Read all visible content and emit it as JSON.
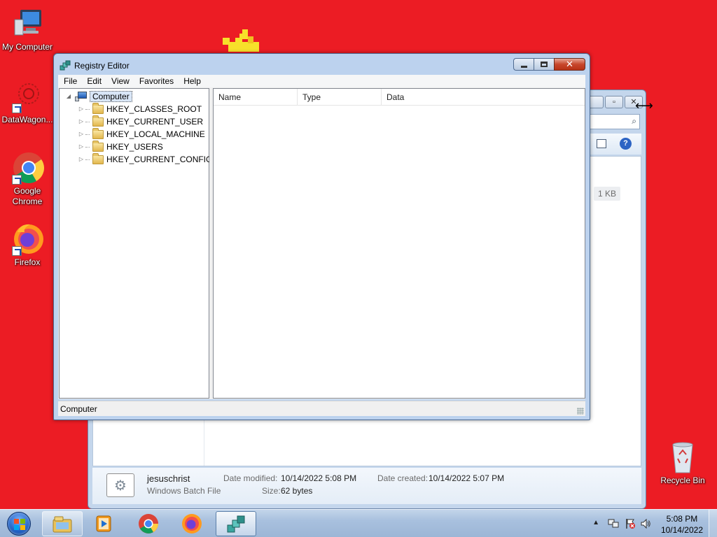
{
  "desktop": {
    "background_color": "#ec1c24",
    "icons": [
      {
        "label": "My Computer",
        "icon": "my-computer-icon"
      },
      {
        "label": "DataWagon...",
        "icon": "datawagon-icon"
      },
      {
        "label": "Google Chrome",
        "icon": "chrome-icon"
      },
      {
        "label": "Firefox",
        "icon": "firefox-icon"
      },
      {
        "label": "Recycle Bin",
        "icon": "recycle-bin-icon"
      }
    ]
  },
  "background_window": {
    "size_badge": "1 KB",
    "details": {
      "file_name": "jesuschrist",
      "file_type": "Windows Batch File",
      "date_modified_label": "Date modified:",
      "date_modified": "10/14/2022 5:08 PM",
      "date_created_label": "Date created:",
      "date_created": "10/14/2022 5:07 PM",
      "size_label": "Size:",
      "size": "62 bytes"
    }
  },
  "regedit": {
    "title": "Registry Editor",
    "menu": [
      "File",
      "Edit",
      "View",
      "Favorites",
      "Help"
    ],
    "tree": {
      "root": "Computer",
      "keys": [
        "HKEY_CLASSES_ROOT",
        "HKEY_CURRENT_USER",
        "HKEY_LOCAL_MACHINE",
        "HKEY_USERS",
        "HKEY_CURRENT_CONFIG"
      ]
    },
    "columns": [
      "Name",
      "Type",
      "Data"
    ],
    "status": "Computer",
    "close_glyph": "✕"
  },
  "taskbar": {
    "pinned": [
      "explorer-icon",
      "media-player-icon",
      "chrome-icon",
      "firefox-icon",
      "regedit-icon"
    ],
    "clock_time": "5:08 PM",
    "clock_date": "10/14/2022"
  }
}
